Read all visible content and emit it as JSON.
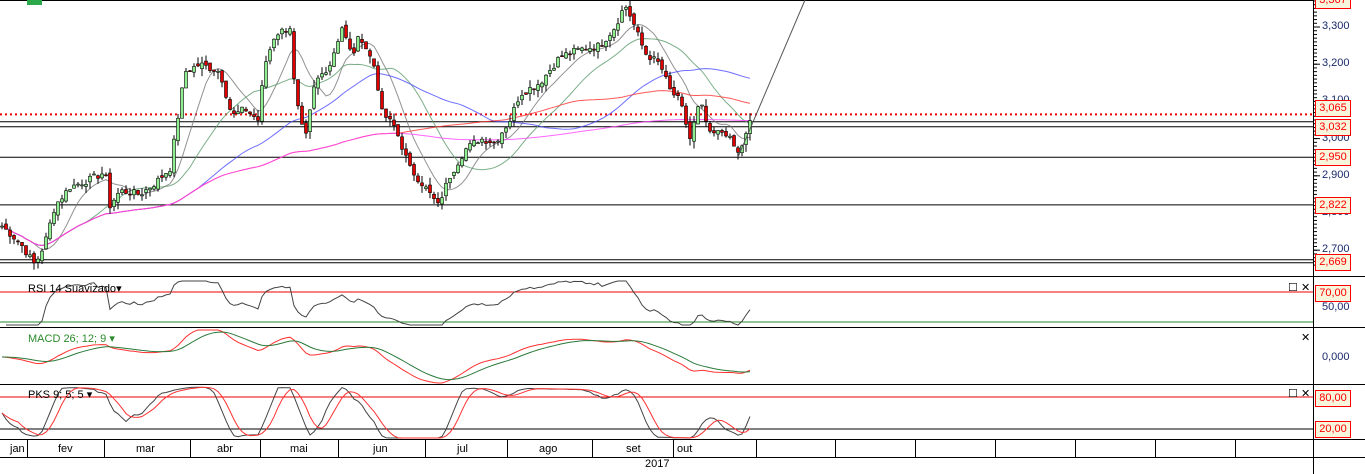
{
  "chart_data": {
    "type": "candlestick",
    "year_label": "2017",
    "months": [
      "jan",
      "fev",
      "mar",
      "abr",
      "mai",
      "jun",
      "jul",
      "ago",
      "set",
      "out"
    ],
    "price_axis_ticks": [
      "3,300",
      "3,200",
      "3,100",
      "3,000",
      "2,900",
      "2,800",
      "2,700"
    ],
    "price_axis_values": [
      3.3,
      3.2,
      3.1,
      3.0,
      2.9,
      2.8,
      2.7
    ],
    "price_range": [
      2.64,
      3.37
    ],
    "level_tags": [
      "3,367",
      "3,065",
      "3,032",
      "2,950",
      "2,822",
      "2,669"
    ],
    "level_values": [
      3.367,
      3.065,
      3.032,
      2.95,
      2.822,
      2.669
    ],
    "close_path": [
      [
        0,
        2.77
      ],
      [
        20,
        2.72
      ],
      [
        35,
        2.66
      ],
      [
        45,
        2.72
      ],
      [
        55,
        2.82
      ],
      [
        70,
        2.87
      ],
      [
        90,
        2.89
      ],
      [
        105,
        2.91
      ],
      [
        110,
        2.82
      ],
      [
        120,
        2.86
      ],
      [
        140,
        2.85
      ],
      [
        155,
        2.88
      ],
      [
        170,
        2.92
      ],
      [
        178,
        3.06
      ],
      [
        185,
        3.18
      ],
      [
        200,
        3.2
      ],
      [
        220,
        3.18
      ],
      [
        232,
        3.06
      ],
      [
        245,
        3.08
      ],
      [
        258,
        3.05
      ],
      [
        265,
        3.2
      ],
      [
        275,
        3.28
      ],
      [
        290,
        3.3
      ],
      [
        295,
        3.12
      ],
      [
        305,
        2.99
      ],
      [
        315,
        3.15
      ],
      [
        330,
        3.2
      ],
      [
        342,
        3.3
      ],
      [
        352,
        3.22
      ],
      [
        360,
        3.28
      ],
      [
        375,
        3.19
      ],
      [
        382,
        3.07
      ],
      [
        395,
        3.03
      ],
      [
        410,
        2.92
      ],
      [
        425,
        2.87
      ],
      [
        438,
        2.82
      ],
      [
        450,
        2.9
      ],
      [
        465,
        2.97
      ],
      [
        480,
        3.0
      ],
      [
        495,
        2.99
      ],
      [
        510,
        3.05
      ],
      [
        520,
        3.12
      ],
      [
        540,
        3.15
      ],
      [
        560,
        3.22
      ],
      [
        580,
        3.24
      ],
      [
        600,
        3.25
      ],
      [
        615,
        3.3
      ],
      [
        625,
        3.36
      ],
      [
        632,
        3.32
      ],
      [
        645,
        3.23
      ],
      [
        660,
        3.2
      ],
      [
        670,
        3.13
      ],
      [
        680,
        3.1
      ],
      [
        690,
        3.0
      ],
      [
        700,
        3.1
      ],
      [
        710,
        3.01
      ],
      [
        725,
        3.02
      ],
      [
        738,
        2.96
      ],
      [
        745,
        3.0
      ],
      [
        752,
        3.06
      ]
    ],
    "moving_averages": [
      {
        "period": 9,
        "color": "#777777"
      },
      {
        "period": 21,
        "color": "#5a9a6a"
      },
      {
        "period": 50,
        "color": "#4a4aff"
      },
      {
        "period": 100,
        "color": "#ff3030"
      },
      {
        "period": 200,
        "color": "#ff40ff"
      }
    ],
    "indicators": {
      "rsi": {
        "title": "RSI 14 Suavizado",
        "tags": [
          "70,00"
        ],
        "ticks": [
          "50,00"
        ]
      },
      "macd": {
        "title": "MACD 26; 12; 9",
        "ticks": [
          "0,000"
        ]
      },
      "pks": {
        "title": "PKS 9; 5; 5",
        "tags": [
          "80,00",
          "20,00"
        ]
      }
    }
  },
  "ui": {
    "dropdown_glyph": "▾",
    "maximize_glyph": "☐",
    "close_glyph": "✕"
  }
}
